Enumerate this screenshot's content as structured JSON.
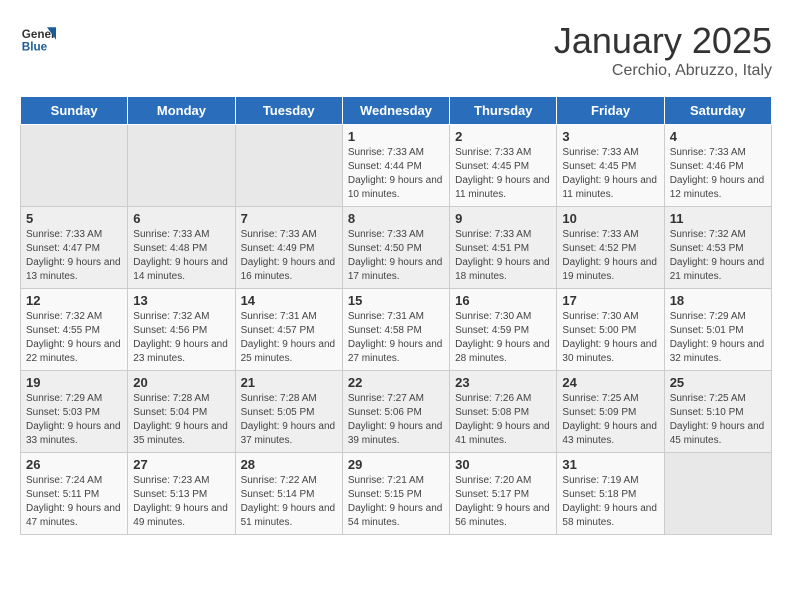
{
  "header": {
    "logo_line1": "General",
    "logo_line2": "Blue",
    "title": "January 2025",
    "subtitle": "Cerchio, Abruzzo, Italy"
  },
  "days_of_week": [
    "Sunday",
    "Monday",
    "Tuesday",
    "Wednesday",
    "Thursday",
    "Friday",
    "Saturday"
  ],
  "weeks": [
    [
      {
        "day": "",
        "info": ""
      },
      {
        "day": "",
        "info": ""
      },
      {
        "day": "",
        "info": ""
      },
      {
        "day": "1",
        "info": "Sunrise: 7:33 AM\nSunset: 4:44 PM\nDaylight: 9 hours and 10 minutes."
      },
      {
        "day": "2",
        "info": "Sunrise: 7:33 AM\nSunset: 4:45 PM\nDaylight: 9 hours and 11 minutes."
      },
      {
        "day": "3",
        "info": "Sunrise: 7:33 AM\nSunset: 4:45 PM\nDaylight: 9 hours and 11 minutes."
      },
      {
        "day": "4",
        "info": "Sunrise: 7:33 AM\nSunset: 4:46 PM\nDaylight: 9 hours and 12 minutes."
      }
    ],
    [
      {
        "day": "5",
        "info": "Sunrise: 7:33 AM\nSunset: 4:47 PM\nDaylight: 9 hours and 13 minutes."
      },
      {
        "day": "6",
        "info": "Sunrise: 7:33 AM\nSunset: 4:48 PM\nDaylight: 9 hours and 14 minutes."
      },
      {
        "day": "7",
        "info": "Sunrise: 7:33 AM\nSunset: 4:49 PM\nDaylight: 9 hours and 16 minutes."
      },
      {
        "day": "8",
        "info": "Sunrise: 7:33 AM\nSunset: 4:50 PM\nDaylight: 9 hours and 17 minutes."
      },
      {
        "day": "9",
        "info": "Sunrise: 7:33 AM\nSunset: 4:51 PM\nDaylight: 9 hours and 18 minutes."
      },
      {
        "day": "10",
        "info": "Sunrise: 7:33 AM\nSunset: 4:52 PM\nDaylight: 9 hours and 19 minutes."
      },
      {
        "day": "11",
        "info": "Sunrise: 7:32 AM\nSunset: 4:53 PM\nDaylight: 9 hours and 21 minutes."
      }
    ],
    [
      {
        "day": "12",
        "info": "Sunrise: 7:32 AM\nSunset: 4:55 PM\nDaylight: 9 hours and 22 minutes."
      },
      {
        "day": "13",
        "info": "Sunrise: 7:32 AM\nSunset: 4:56 PM\nDaylight: 9 hours and 23 minutes."
      },
      {
        "day": "14",
        "info": "Sunrise: 7:31 AM\nSunset: 4:57 PM\nDaylight: 9 hours and 25 minutes."
      },
      {
        "day": "15",
        "info": "Sunrise: 7:31 AM\nSunset: 4:58 PM\nDaylight: 9 hours and 27 minutes."
      },
      {
        "day": "16",
        "info": "Sunrise: 7:30 AM\nSunset: 4:59 PM\nDaylight: 9 hours and 28 minutes."
      },
      {
        "day": "17",
        "info": "Sunrise: 7:30 AM\nSunset: 5:00 PM\nDaylight: 9 hours and 30 minutes."
      },
      {
        "day": "18",
        "info": "Sunrise: 7:29 AM\nSunset: 5:01 PM\nDaylight: 9 hours and 32 minutes."
      }
    ],
    [
      {
        "day": "19",
        "info": "Sunrise: 7:29 AM\nSunset: 5:03 PM\nDaylight: 9 hours and 33 minutes."
      },
      {
        "day": "20",
        "info": "Sunrise: 7:28 AM\nSunset: 5:04 PM\nDaylight: 9 hours and 35 minutes."
      },
      {
        "day": "21",
        "info": "Sunrise: 7:28 AM\nSunset: 5:05 PM\nDaylight: 9 hours and 37 minutes."
      },
      {
        "day": "22",
        "info": "Sunrise: 7:27 AM\nSunset: 5:06 PM\nDaylight: 9 hours and 39 minutes."
      },
      {
        "day": "23",
        "info": "Sunrise: 7:26 AM\nSunset: 5:08 PM\nDaylight: 9 hours and 41 minutes."
      },
      {
        "day": "24",
        "info": "Sunrise: 7:25 AM\nSunset: 5:09 PM\nDaylight: 9 hours and 43 minutes."
      },
      {
        "day": "25",
        "info": "Sunrise: 7:25 AM\nSunset: 5:10 PM\nDaylight: 9 hours and 45 minutes."
      }
    ],
    [
      {
        "day": "26",
        "info": "Sunrise: 7:24 AM\nSunset: 5:11 PM\nDaylight: 9 hours and 47 minutes."
      },
      {
        "day": "27",
        "info": "Sunrise: 7:23 AM\nSunset: 5:13 PM\nDaylight: 9 hours and 49 minutes."
      },
      {
        "day": "28",
        "info": "Sunrise: 7:22 AM\nSunset: 5:14 PM\nDaylight: 9 hours and 51 minutes."
      },
      {
        "day": "29",
        "info": "Sunrise: 7:21 AM\nSunset: 5:15 PM\nDaylight: 9 hours and 54 minutes."
      },
      {
        "day": "30",
        "info": "Sunrise: 7:20 AM\nSunset: 5:17 PM\nDaylight: 9 hours and 56 minutes."
      },
      {
        "day": "31",
        "info": "Sunrise: 7:19 AM\nSunset: 5:18 PM\nDaylight: 9 hours and 58 minutes."
      },
      {
        "day": "",
        "info": ""
      }
    ]
  ]
}
